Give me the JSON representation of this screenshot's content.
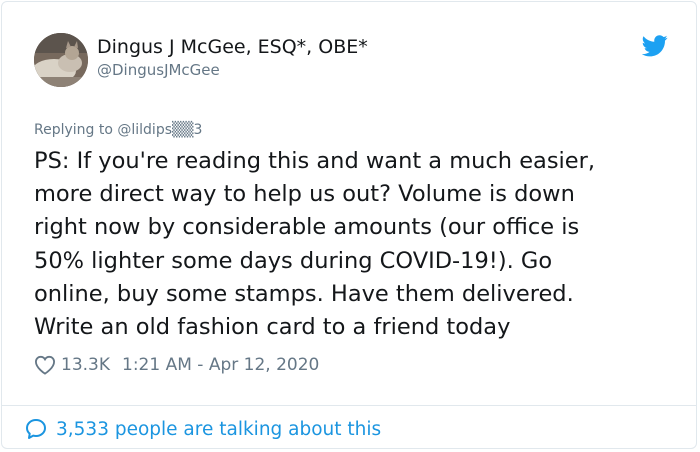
{
  "tweet": {
    "author": {
      "display_name": "Dingus J McGee, ESQ*, OBE*",
      "handle": "@DingusJMcGee"
    },
    "replying_to": "Replying to @lildips▒▒3",
    "text": "PS: If you're reading this and want a much easier,\nmore direct way to help us out? Volume is down\nright now by considerable amounts (our office is\n50% lighter some days during COVID-19!). Go\nonline, buy some stamps. Have them delivered.\nWrite an old fashion card to a friend today",
    "likes": "13.3K",
    "timestamp": "1:21 AM - Apr 12, 2020",
    "talking_label": "3,533 people are talking about this"
  },
  "colors": {
    "brand_blue": "#1da1f2",
    "link_blue": "#1b95e0",
    "secondary_text": "#657786",
    "border": "#e1e8ed"
  },
  "icons": {
    "brand": "twitter-bird-icon",
    "like": "heart-outline-icon",
    "reply": "speech-bubble-icon"
  }
}
